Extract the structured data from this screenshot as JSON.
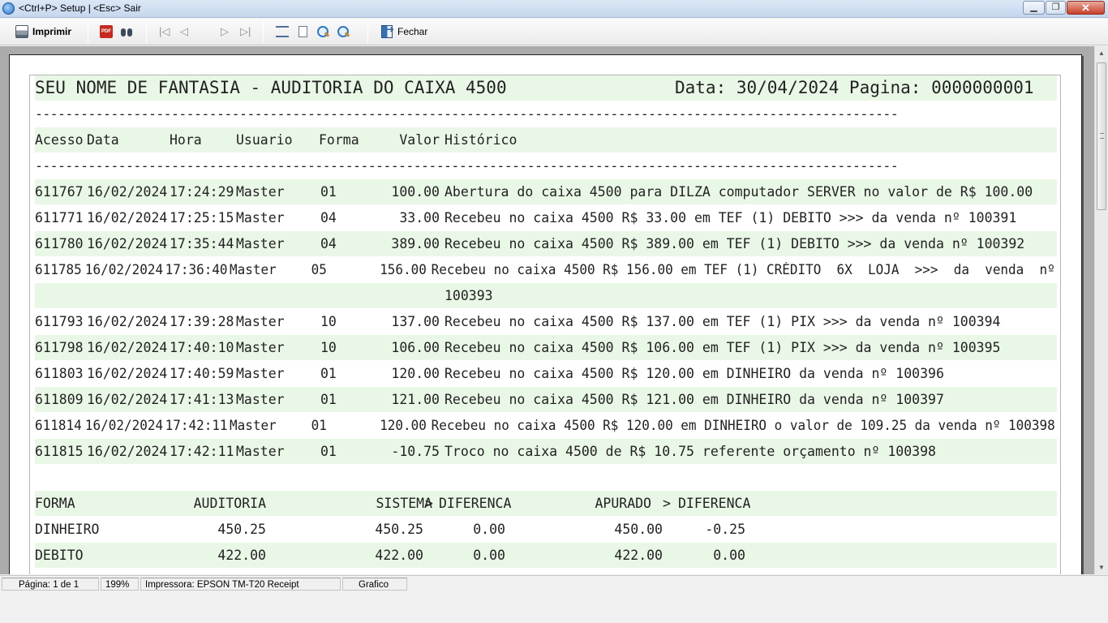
{
  "window": {
    "title": "<Ctrl+P> Setup | <Esc> Sair",
    "minimize": "▁",
    "maximize": "❐",
    "close": "✕"
  },
  "toolbar": {
    "print_label": "Imprimir",
    "close_label": "Fechar",
    "nav": {
      "first": "|◁",
      "prev": "◁",
      "next": "▷",
      "last": "▷|"
    },
    "pdf_glyph": "PDF"
  },
  "report": {
    "header_left": "SEU NOME DE FANTASIA - AUDITORIA DO CAIXA 4500",
    "header_right": "Data: 30/04/2024 Pagina: 0000000001",
    "dashes": "------------------------------------------------------------------------------------------------------------------",
    "columns": {
      "acesso": "Acesso",
      "data": "Data",
      "hora": "Hora",
      "usuario": "Usuario",
      "forma": "Forma",
      "valor": "Valor",
      "historico": "Histórico"
    },
    "rows": [
      {
        "acesso": "611767",
        "data": "16/02/2024",
        "hora": "17:24:29",
        "usuario": "Master",
        "forma": "01",
        "valor": "100.00",
        "historico": "Abertura do caixa 4500 para DILZA computador SERVER no valor de R$ 100.00"
      },
      {
        "acesso": "611771",
        "data": "16/02/2024",
        "hora": "17:25:15",
        "usuario": "Master",
        "forma": "04",
        "valor": "33.00",
        "historico": "Recebeu no caixa 4500 R$ 33.00 em TEF (1) DEBITO >>> da venda nº 100391"
      },
      {
        "acesso": "611780",
        "data": "16/02/2024",
        "hora": "17:35:44",
        "usuario": "Master",
        "forma": "04",
        "valor": "389.00",
        "historico": "Recebeu no caixa 4500 R$ 389.00 em TEF (1) DEBITO >>> da venda nº 100392"
      },
      {
        "acesso": "611785",
        "data": "16/02/2024",
        "hora": "17:36:40",
        "usuario": "Master",
        "forma": "05",
        "valor": "156.00",
        "historico": "Recebeu no caixa 4500 R$ 156.00 em TEF (1) CRÉDITO  6X  LOJA  >>>  da  venda  nº",
        "historico_cont": "100393"
      },
      {
        "acesso": "611793",
        "data": "16/02/2024",
        "hora": "17:39:28",
        "usuario": "Master",
        "forma": "10",
        "valor": "137.00",
        "historico": "Recebeu no caixa 4500 R$ 137.00 em TEF (1) PIX >>> da venda nº 100394"
      },
      {
        "acesso": "611798",
        "data": "16/02/2024",
        "hora": "17:40:10",
        "usuario": "Master",
        "forma": "10",
        "valor": "106.00",
        "historico": "Recebeu no caixa 4500 R$ 106.00 em TEF (1) PIX >>> da venda nº 100395"
      },
      {
        "acesso": "611803",
        "data": "16/02/2024",
        "hora": "17:40:59",
        "usuario": "Master",
        "forma": "01",
        "valor": "120.00",
        "historico": "Recebeu no caixa 4500 R$ 120.00 em DINHEIRO da venda nº 100396"
      },
      {
        "acesso": "611809",
        "data": "16/02/2024",
        "hora": "17:41:13",
        "usuario": "Master",
        "forma": "01",
        "valor": "121.00",
        "historico": "Recebeu no caixa 4500 R$ 121.00 em DINHEIRO da venda nº 100397"
      },
      {
        "acesso": "611814",
        "data": "16/02/2024",
        "hora": "17:42:11",
        "usuario": "Master",
        "forma": "01",
        "valor": "120.00",
        "historico": "Recebeu no caixa 4500 R$ 120.00 em DINHEIRO o valor de 109.25 da venda nº 100398"
      },
      {
        "acesso": "611815",
        "data": "16/02/2024",
        "hora": "17:42:11",
        "usuario": "Master",
        "forma": "01",
        "valor": "-10.75",
        "historico": "Troco no caixa 4500 de R$ 10.75 referente orçamento nº 100398"
      }
    ],
    "summary_columns": {
      "forma": "FORMA",
      "auditoria": "AUDITORIA",
      "sistema": "SISTEMA",
      "arrow1": ">",
      "diferenca1": "DIFERENCA",
      "apurado": "APURADO",
      "arrow2": ">",
      "diferenca2": "DIFERENCA"
    },
    "summary_rows": [
      {
        "forma": "DINHEIRO",
        "auditoria": "450.25",
        "sistema": "450.25",
        "diferenca1": "0.00",
        "apurado": "450.00",
        "diferenca2": "-0.25"
      },
      {
        "forma": "DEBITO",
        "auditoria": "422.00",
        "sistema": "422.00",
        "diferenca1": "0.00",
        "apurado": "422.00",
        "diferenca2": "0.00"
      }
    ]
  },
  "status": {
    "page": "Página: 1 de 1",
    "zoom": "199%",
    "printer": "Impressora: EPSON TM-T20 Receipt",
    "mode": "Grafico"
  },
  "scrollbar": {
    "up": "▲",
    "down": "▼"
  }
}
